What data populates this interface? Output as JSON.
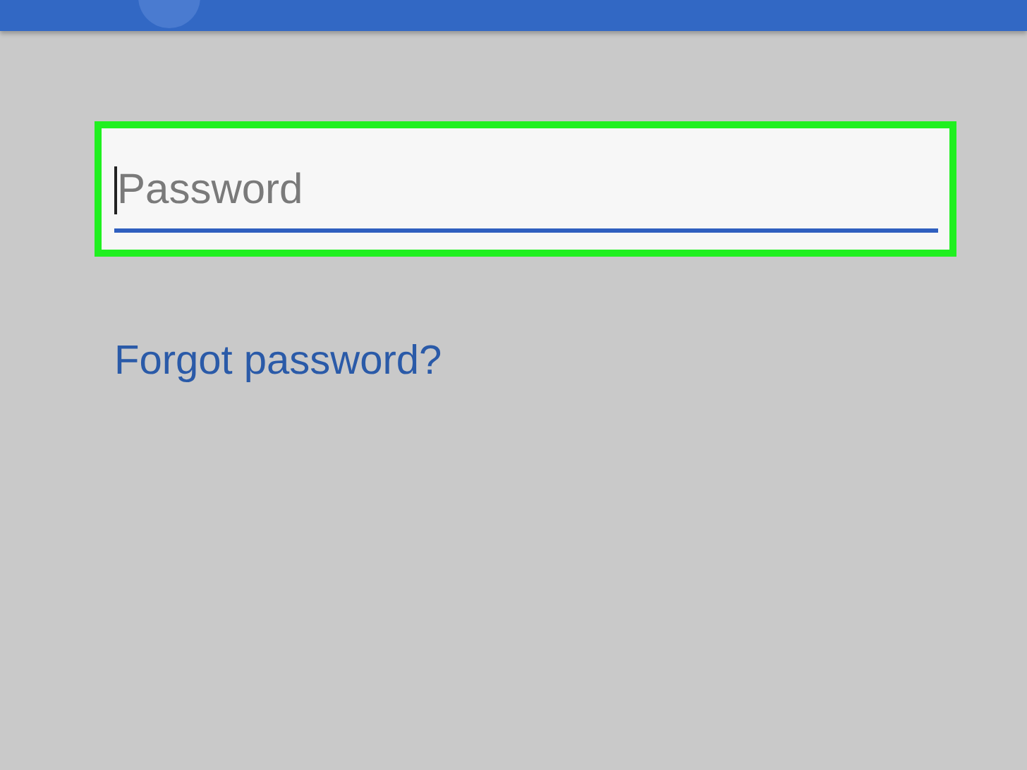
{
  "top_bar": {
    "avatar": true
  },
  "password_field": {
    "placeholder": "Password",
    "highlighted": true,
    "focused": true
  },
  "forgot_link": "Forgot password?"
}
